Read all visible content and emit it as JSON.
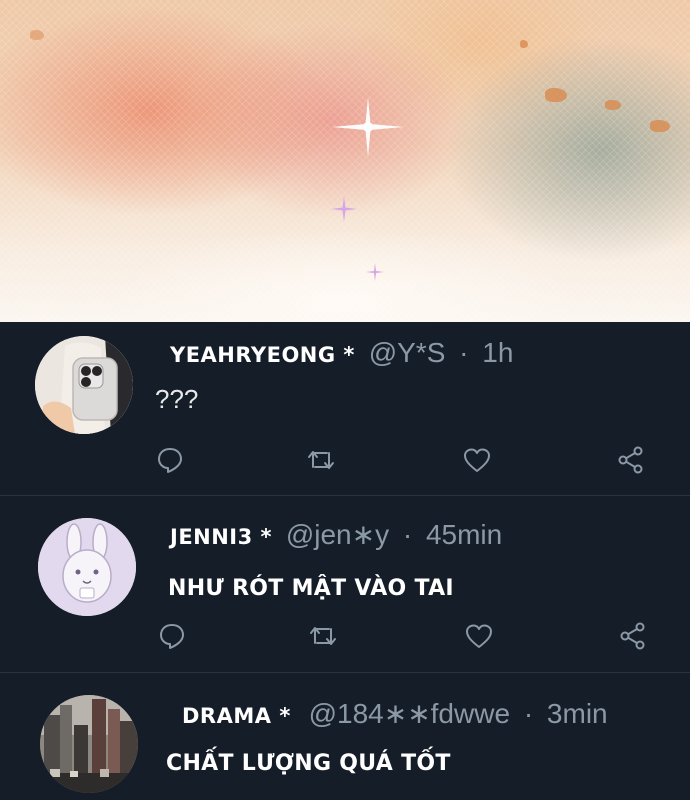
{
  "tweets": [
    {
      "name": "YEAHRYEONG *",
      "handle": "@Y*S",
      "separator": "·",
      "time": "1h",
      "text": "???"
    },
    {
      "name": "JENNI3 *",
      "handle": "@jen∗y",
      "separator": "·",
      "time": "45min",
      "text": "NHƯ RÓT MẬT VÀO TAI"
    },
    {
      "name": "DRAMA *",
      "handle": "@184∗∗fdwwe",
      "separator": "·",
      "time": "3min",
      "text": "CHẤT LƯỢNG QUÁ TỐT"
    }
  ],
  "actions": [
    "reply-icon",
    "retweet-icon",
    "like-icon",
    "share-icon"
  ],
  "colors": {
    "background": "#151d29",
    "icon": "#8b98a5",
    "name": "#ffffff",
    "meta": "#8b98a5"
  }
}
